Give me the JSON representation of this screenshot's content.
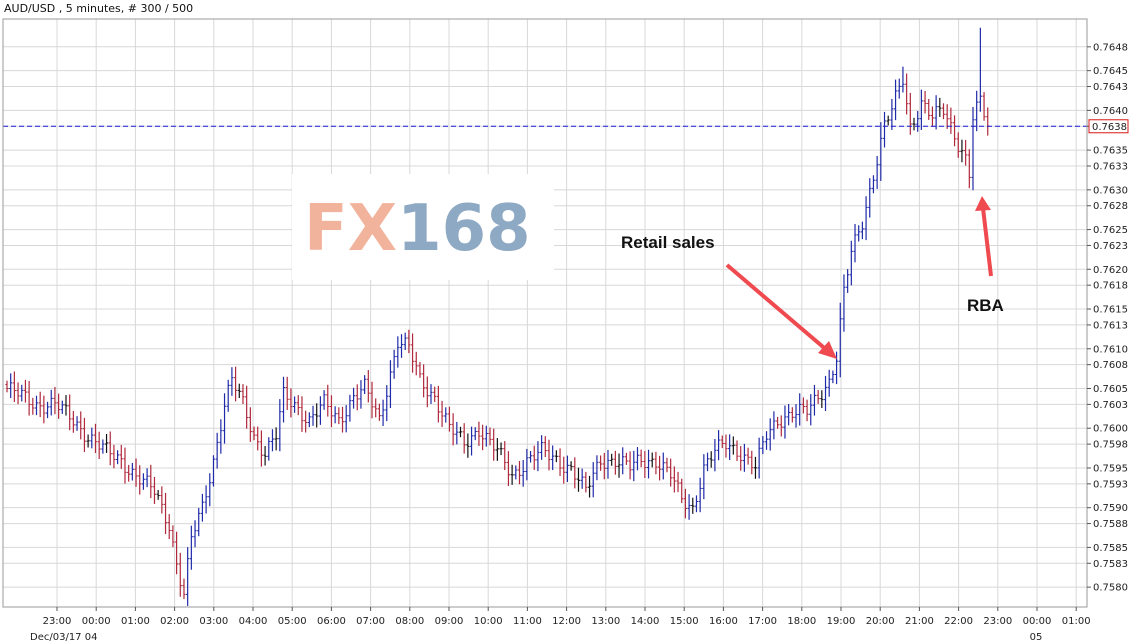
{
  "header": {
    "title": "AUD/USD , 5 minutes, # 300 / 500"
  },
  "watermark": {
    "part1": "FX",
    "part2": "168",
    "part1_color": "#f2b39d",
    "part2_color": "#8ea9c3"
  },
  "colors": {
    "up_bar": "#1f2aa8",
    "down_bar": "#b0283c",
    "neutral_bar": "#111111",
    "grid": "#d8d8d8",
    "current_line": "#1a1ad6",
    "price_box_border": "#d81818",
    "arrow": "#ef4a4f"
  },
  "annotations": [
    {
      "label": "Retail sales"
    },
    {
      "label": "RBA"
    }
  ],
  "chart_data": {
    "type": "ohlc",
    "title": "AUD/USD , 5 minutes, # 300 / 500",
    "xlabel": "",
    "ylabel": "",
    "ylim": [
      0.75775,
      0.76515
    ],
    "y_ticks": [
      "0.7648",
      "0.7645",
      "0.7643",
      "0.7640",
      "0.7638",
      "0.7635",
      "0.7633",
      "0.7630",
      "0.7628",
      "0.7625",
      "0.7623",
      "0.7620",
      "0.7618",
      "0.7615",
      "0.7613",
      "0.7610",
      "0.7608",
      "0.7605",
      "0.7603",
      "0.7600",
      "0.7598",
      "0.7595",
      "0.7593",
      "0.7590",
      "0.7588",
      "0.7585",
      "0.7583",
      "0.7580"
    ],
    "x_ticks": [
      "23:00",
      "00:00",
      "01:00",
      "02:00",
      "03:00",
      "04:00",
      "05:00",
      "06:00",
      "07:00",
      "08:00",
      "09:00",
      "10:00",
      "11:00",
      "12:00",
      "13:00",
      "14:00",
      "15:00",
      "16:00",
      "17:00",
      "18:00",
      "19:00",
      "20:00",
      "21:00",
      "22:00",
      "23:00",
      "00:00",
      "01:00"
    ],
    "x_sub_labels": [
      "Dec/03/17  04",
      "05"
    ],
    "current_price": 0.7638,
    "current_price_label": "0.7638",
    "grid": true,
    "anchors": [
      [
        0,
        0.7605
      ],
      [
        8,
        0.7603
      ],
      [
        13,
        0.7603
      ],
      [
        18,
        0.7601
      ],
      [
        22,
        0.7599
      ],
      [
        27,
        0.7597
      ],
      [
        31,
        0.7596
      ],
      [
        35,
        0.7594
      ],
      [
        40,
        0.7592
      ],
      [
        44,
        0.7588
      ],
      [
        46,
        0.7583
      ],
      [
        48,
        0.7579
      ],
      [
        50,
        0.7586
      ],
      [
        53,
        0.759
      ],
      [
        56,
        0.7596
      ],
      [
        59,
        0.7603
      ],
      [
        61,
        0.7606
      ],
      [
        64,
        0.7603
      ],
      [
        67,
        0.7599
      ],
      [
        70,
        0.7597
      ],
      [
        73,
        0.7599
      ],
      [
        75,
        0.7604
      ],
      [
        78,
        0.7603
      ],
      [
        82,
        0.7601
      ],
      [
        86,
        0.7603
      ],
      [
        90,
        0.7601
      ],
      [
        94,
        0.7604
      ],
      [
        97,
        0.7605
      ],
      [
        101,
        0.7601
      ],
      [
        103,
        0.7605
      ],
      [
        106,
        0.7611
      ],
      [
        109,
        0.761
      ],
      [
        112,
        0.7606
      ],
      [
        116,
        0.7604
      ],
      [
        120,
        0.76
      ],
      [
        124,
        0.7598
      ],
      [
        128,
        0.76
      ],
      [
        133,
        0.7597
      ],
      [
        137,
        0.7594
      ],
      [
        141,
        0.7596
      ],
      [
        145,
        0.7597
      ],
      [
        149,
        0.7596
      ],
      [
        153,
        0.7595
      ],
      [
        157,
        0.7592
      ],
      [
        161,
        0.7596
      ],
      [
        165,
        0.7596
      ],
      [
        169,
        0.7595
      ],
      [
        172,
        0.7596
      ],
      [
        176,
        0.7596
      ],
      [
        180,
        0.7594
      ],
      [
        183,
        0.7591
      ],
      [
        186,
        0.759
      ],
      [
        189,
        0.7595
      ],
      [
        192,
        0.7597
      ],
      [
        195,
        0.7598
      ],
      [
        199,
        0.7597
      ],
      [
        203,
        0.7595
      ],
      [
        206,
        0.7599
      ],
      [
        209,
        0.7601
      ],
      [
        213,
        0.7602
      ],
      [
        217,
        0.7602
      ],
      [
        220,
        0.7604
      ],
      [
        223,
        0.7606
      ],
      [
        225,
        0.7609
      ],
      [
        227,
        0.7617
      ],
      [
        229,
        0.7622
      ],
      [
        232,
        0.7626
      ],
      [
        235,
        0.7632
      ],
      [
        238,
        0.7638
      ],
      [
        240,
        0.764
      ],
      [
        243,
        0.7644
      ],
      [
        245,
        0.7638
      ],
      [
        248,
        0.7641
      ],
      [
        251,
        0.7639
      ],
      [
        254,
        0.764
      ],
      [
        257,
        0.7637
      ],
      [
        260,
        0.7634
      ],
      [
        261,
        0.7632
      ],
      [
        262,
        0.7639
      ],
      [
        264,
        0.7641
      ],
      [
        266,
        0.7638
      ]
    ],
    "last_index": 266
  }
}
